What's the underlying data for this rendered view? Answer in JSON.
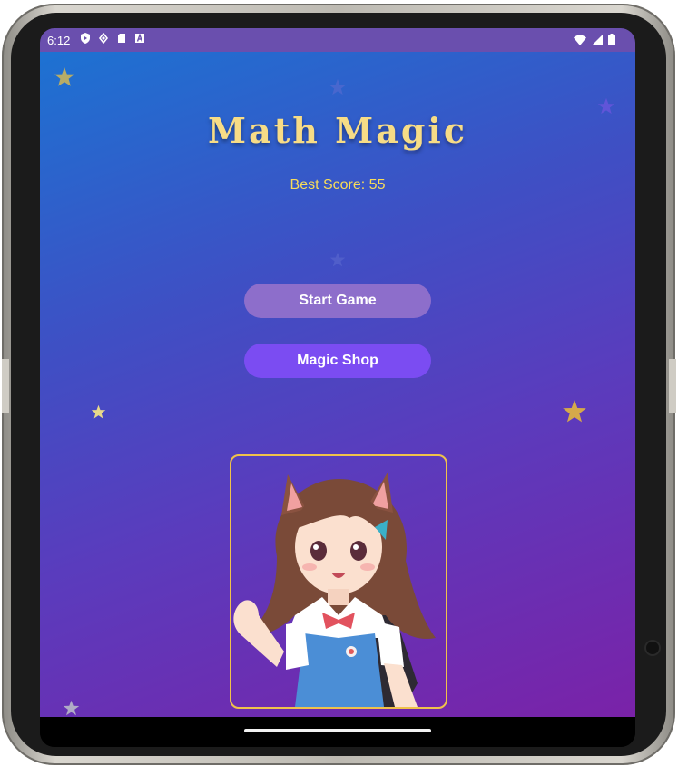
{
  "status_bar": {
    "time": "6:12",
    "left_icons": [
      "shield-play-icon",
      "signal-diamond-icon",
      "sd-card-icon",
      "font-a-icon"
    ],
    "right_icons": [
      "wifi-icon",
      "cell-signal-icon",
      "battery-icon"
    ]
  },
  "app": {
    "title": "Math Magic",
    "best_score": "Best Score: 55",
    "buttons": {
      "start": "Start Game",
      "shop": "Magic Shop"
    },
    "character_image": "anime-cat-ear-girl-waving"
  },
  "colors": {
    "gradient_start": "#1d72d2",
    "gradient_end": "#7a22a8",
    "title_gold": "#f7dc86",
    "score_yellow": "#f7dc5a",
    "start_button": "#8d6ecb",
    "shop_button": "#7b4cf2",
    "card_border": "#f0c24a"
  }
}
